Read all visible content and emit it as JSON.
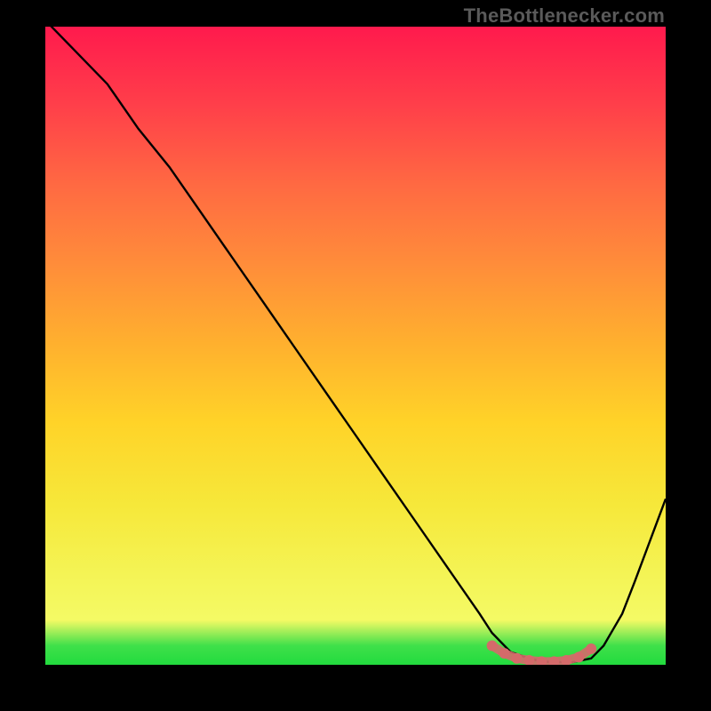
{
  "watermark": "TheBottleneckеr.com",
  "chart_data": {
    "type": "line",
    "title": "",
    "xlabel": "",
    "ylabel": "",
    "xlim": [
      0,
      100
    ],
    "ylim": [
      0,
      100
    ],
    "x": [
      0,
      5,
      10,
      15,
      20,
      25,
      30,
      35,
      40,
      45,
      50,
      55,
      60,
      65,
      70,
      72,
      75,
      78,
      80,
      83,
      85,
      88,
      90,
      93,
      95,
      100
    ],
    "values": [
      101,
      96,
      91,
      84,
      78,
      71,
      64,
      57,
      50,
      43,
      36,
      29,
      22,
      15,
      8,
      5,
      2,
      1,
      0.5,
      0.4,
      0.4,
      1,
      3,
      8,
      13,
      26
    ],
    "marker_region": {
      "x": [
        72,
        74,
        76,
        78,
        80,
        82,
        84,
        86,
        88
      ],
      "y": [
        3.0,
        1.8,
        1.0,
        0.7,
        0.5,
        0.5,
        0.7,
        1.2,
        2.5
      ]
    },
    "colors": {
      "line": "#000000",
      "marker": "#d46a6a",
      "gradient_top": "#ff1a4d",
      "gradient_bottom": "#22db3e"
    }
  }
}
